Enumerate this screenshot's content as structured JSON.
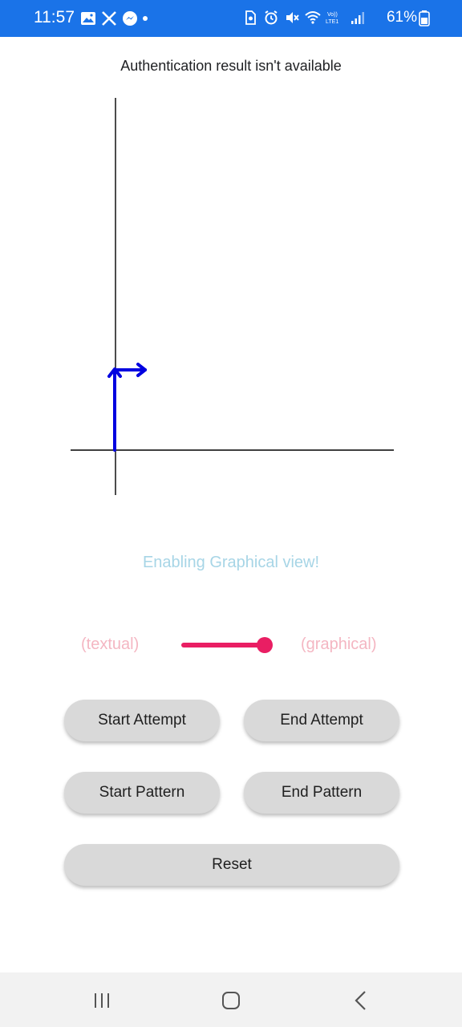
{
  "status_bar": {
    "time": "11:57",
    "battery_percent": "61%",
    "left_icons": [
      "gallery-icon",
      "x-icon",
      "messenger-icon",
      "dot-icon"
    ],
    "right_icons": [
      "sim-icon",
      "alarm-icon",
      "mute-icon",
      "wifi-icon",
      "volte-icon",
      "signal-icon",
      "battery-icon"
    ],
    "volte_label": "Vo))\nLTE1",
    "color": "#1a73e8"
  },
  "auth": {
    "result_text": "Authentication result isn't available"
  },
  "graph": {
    "axis_color": "#000000",
    "path_color": "#0000e0",
    "path_moves": [
      "up",
      "right"
    ]
  },
  "mode": {
    "message": "Enabling Graphical view!",
    "message_color": "#a7d5e6",
    "left_label": "(textual)",
    "right_label": "(graphical)",
    "label_color": "#f4b6c2",
    "toggle_color": "#e91e63",
    "graphical_enabled": true
  },
  "buttons": {
    "start_attempt": "Start Attempt",
    "end_attempt": "End Attempt",
    "start_pattern": "Start Pattern",
    "end_pattern": "End Pattern",
    "reset": "Reset"
  },
  "nav_bar": {
    "icons": [
      "recent-apps-icon",
      "home-icon",
      "back-icon"
    ]
  }
}
